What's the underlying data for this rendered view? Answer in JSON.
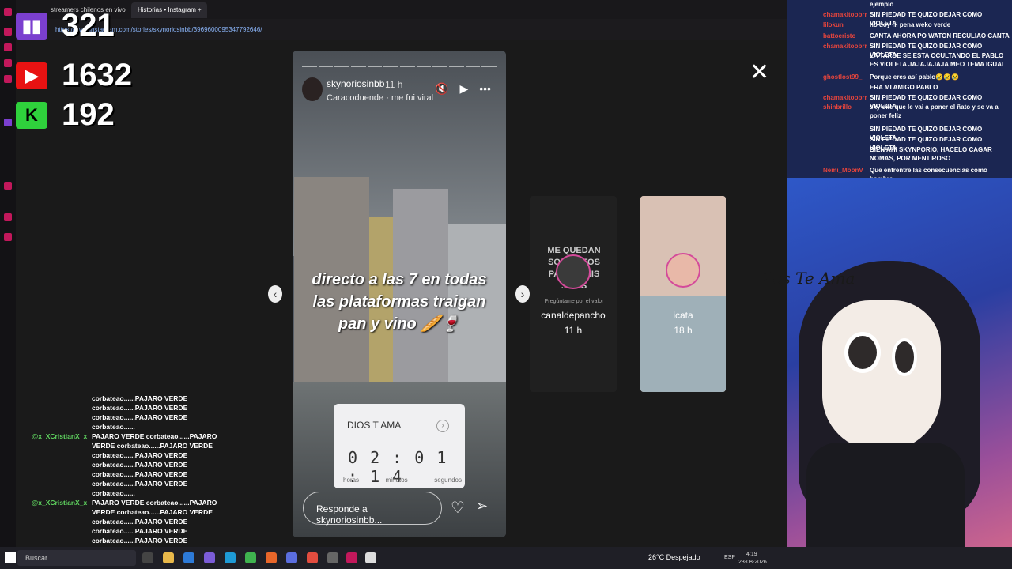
{
  "browser": {
    "tabs": [
      {
        "label": "streamers chilenos en vivo"
      },
      {
        "label": "Historias • Instagram"
      }
    ],
    "new_tab": "+",
    "url": "https://www.instagram.com/stories/skynoriosinbb/3969600095347792646/"
  },
  "overlay": {
    "twitch_count": "321",
    "youtube_count": "1632",
    "kick_count": "192",
    "kick_letter": "K"
  },
  "story": {
    "username": "skynoriosinbb",
    "time": "11 h",
    "song": "Caracoduende · me fui viral",
    "caption": "directo a las 7 en todas las plataformas traigan pan y vino 🥖🍷",
    "countdown": {
      "title": "DIOS T AMA",
      "digits": "0 2 : 0 1 : 1 4",
      "labels": [
        "horas",
        "minutos",
        "segundos"
      ]
    },
    "reply_placeholder": "Responde a skynoriosinbb..."
  },
  "previews": [
    {
      "text": "ME QUEDAN SOLO ...TOS PA... EN MIS ...NAS",
      "subtitle": "Pregúntame por el valor",
      "user": "canaldepancho",
      "time": "11 h"
    },
    {
      "user": "icata",
      "time": "18 h"
    }
  ],
  "chat_left": [
    {
      "user": "",
      "msg": "corbateao......PAJARO VERDE"
    },
    {
      "user": "",
      "msg": "corbateao......PAJARO VERDE"
    },
    {
      "user": "",
      "msg": "corbateao......PAJARO VERDE"
    },
    {
      "user": "",
      "msg": "corbateao......"
    },
    {
      "user": "@x_XCristianX_x",
      "msg": "PAJARO VERDE corbateao......PAJARO"
    },
    {
      "user": "",
      "msg": "VERDE corbateao......PAJARO VERDE"
    },
    {
      "user": "",
      "msg": "corbateao......PAJARO VERDE"
    },
    {
      "user": "",
      "msg": "corbateao......PAJARO VERDE"
    },
    {
      "user": "",
      "msg": "corbateao......PAJARO VERDE"
    },
    {
      "user": "",
      "msg": "corbateao......PAJARO VERDE"
    },
    {
      "user": "",
      "msg": "corbateao......"
    },
    {
      "user": "@x_XCristianX_x",
      "msg": "PAJARO VERDE corbateao......PAJARO"
    },
    {
      "user": "",
      "msg": "VERDE corbateao......PAJARO VERDE"
    },
    {
      "user": "",
      "msg": "corbateao......PAJARO VERDE"
    },
    {
      "user": "",
      "msg": "corbateao......PAJARO VERDE"
    },
    {
      "user": "",
      "msg": "corbateao......PAJARO VERDE"
    },
    {
      "user": "",
      "msg": "corbateao......PAJARO VERDE"
    }
  ],
  "chat_right": [
    {
      "user": "",
      "msg": "ejemplo"
    },
    {
      "user": "chamakitoobrr",
      "msg": "SIN PIEDAD TE QUIZO DEJAR COMO VIOLETA"
    },
    {
      "user": "lilokun",
      "msg": "no doy ni pena weko verde"
    },
    {
      "user": "battocristo",
      "msg": "CANTA AHORA PO WATON RECULIAO CANTA"
    },
    {
      "user": "chamakitoobrr",
      "msg": "SIN PIEDAD TE QUIZO DEJAR COMO VIOLETA"
    },
    {
      "user": "",
      "msg": "LA TARDE SE ESTA OCULTANDO EL PABLO ES VIOLETA JAJAJAJAJA MEO TEMA IGUAL"
    },
    {
      "user": "ghostlost99_",
      "msg": "Porque eres así pablo😢😢😢"
    },
    {
      "user": "",
      "msg": "ERA MI AMIGO PABLO"
    },
    {
      "user": "chamakitoobrr",
      "msg": "SIN PIEDAD TE QUIZO DEJAR COMO VIOLETA"
    },
    {
      "user": "shinbrillo",
      "msg": "sky dile que le vai a poner el ñato y se va a poner feliz"
    },
    {
      "user": "",
      "msg": "SIN PIEDAD TE QUIZO DEJAR COMO VIOLETA"
    },
    {
      "user": "",
      "msg": "SIN PIEDAD TE QUIZO DEJAR COMO VIOLETA"
    },
    {
      "user": "",
      "msg": "BIEN AHI SKYNPORIO, HACELO CAGAR NOMAS, POR MENTIROSO"
    },
    {
      "user": "Nemi_MoonV",
      "msg": "Que enfrentre las consecuencias como hombre"
    }
  ],
  "side_art_text": "Dios Te Ama",
  "taskbar": {
    "search": "Buscar",
    "weather": "26°C  Despejado",
    "lang": "ESP",
    "time": "4:19",
    "date": "23-08-2026"
  },
  "colors": {
    "instagram_ring": "#d44a9a",
    "twitch": "#7b3fcf",
    "youtube": "#e81212",
    "kick": "#2fd13c"
  }
}
